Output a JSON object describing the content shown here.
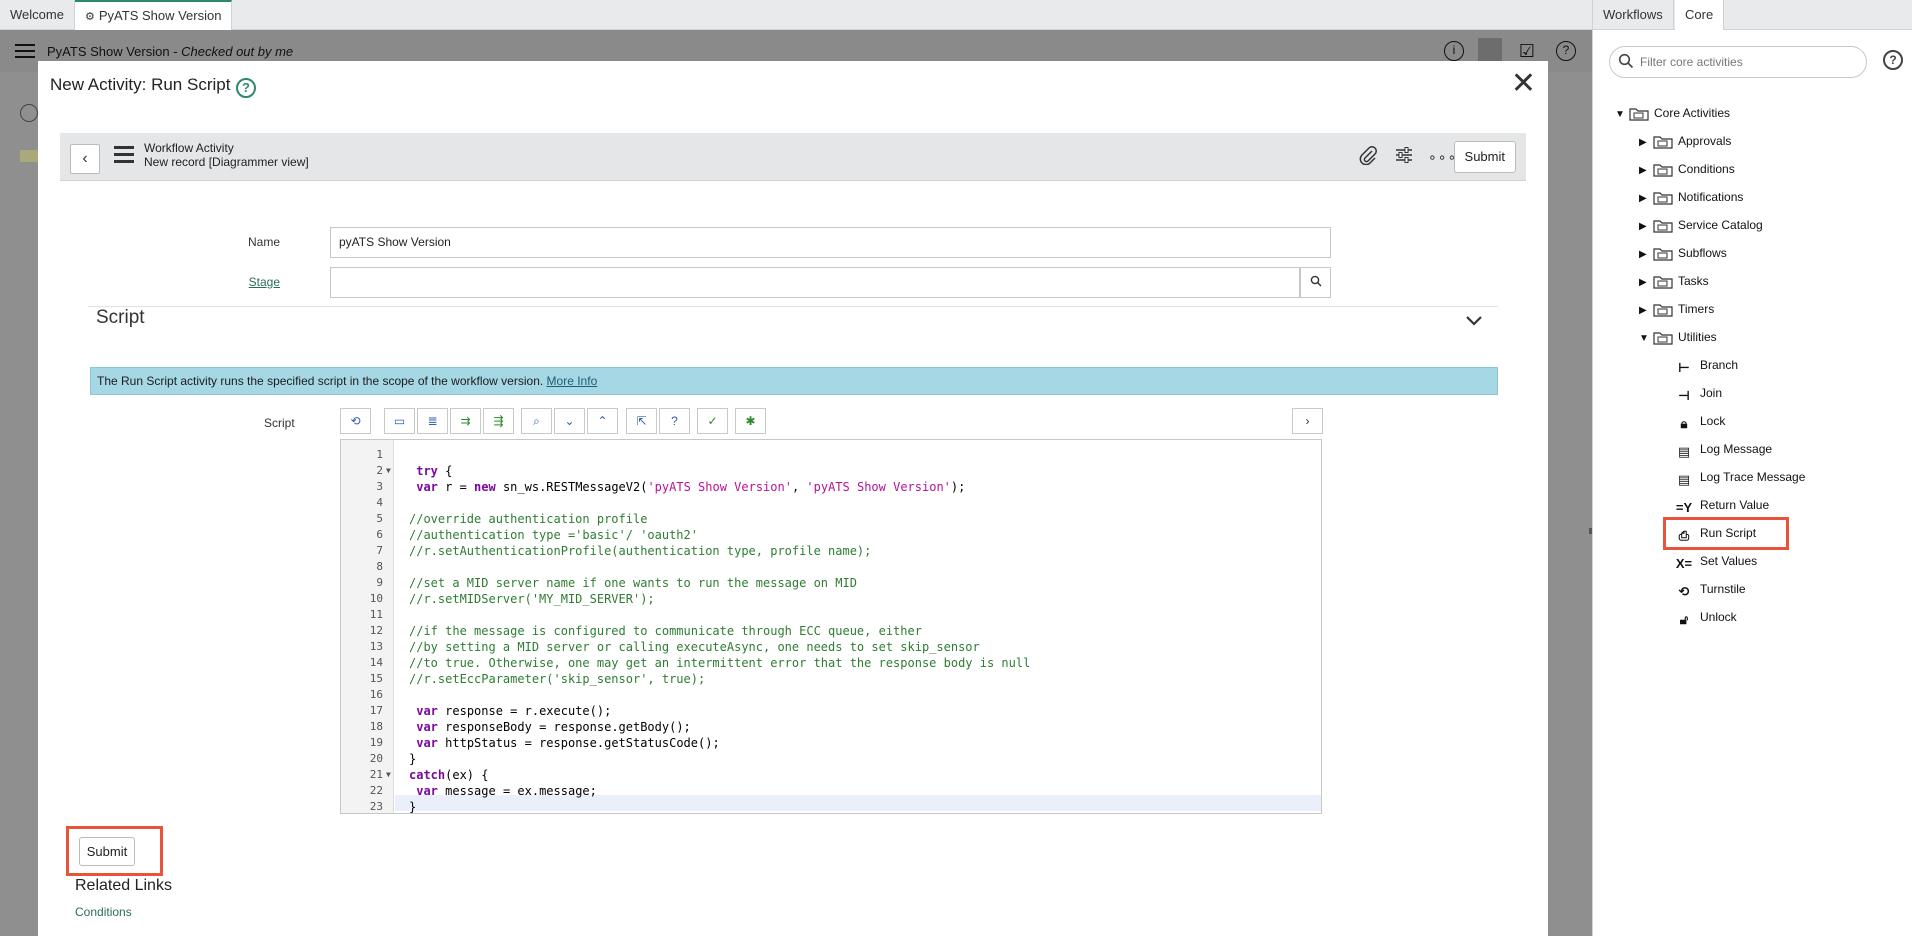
{
  "tabs": [
    {
      "label": "Welcome"
    },
    {
      "label": "PyATS Show Version"
    }
  ],
  "app_header": {
    "title": "PyATS Show Version - ",
    "status": "Checked out by me"
  },
  "modal": {
    "title": "New Activity: Run Script",
    "help_icon": "?",
    "close_icon": "✕"
  },
  "record_header": {
    "type": "Workflow Activity",
    "subtitle": "New record [Diagrammer view]",
    "submit_label": "Submit"
  },
  "form": {
    "name_label": "Name",
    "name_value": "pyATS Show Version",
    "stage_label": "Stage",
    "stage_value": ""
  },
  "script_section": {
    "header": "Script",
    "info_text": "The Run Script activity runs the specified script in the scope of the workflow version.",
    "info_link": "More Info",
    "script_label": "Script"
  },
  "code_lines": [
    "",
    " try {",
    " var r = new sn_ws.RESTMessageV2('pyATS Show Version', 'pyATS Show Version');",
    "",
    "//override authentication profile",
    "//authentication type ='basic'/ 'oauth2'",
    "//r.setAuthenticationProfile(authentication type, profile name);",
    "",
    "//set a MID server name if one wants to run the message on MID",
    "//r.setMIDServer('MY_MID_SERVER');",
    "",
    "//if the message is configured to communicate through ECC queue, either",
    "//by setting a MID server or calling executeAsync, one needs to set skip_sensor",
    "//to true. Otherwise, one may get an intermittent error that the response body is null",
    "//r.setEccParameter('skip_sensor', true);",
    "",
    " var response = r.execute();",
    " var responseBody = response.getBody();",
    " var httpStatus = response.getStatusCode();",
    "}",
    "catch(ex) {",
    " var message = ex.message;",
    "}"
  ],
  "bottom": {
    "submit_label": "Submit",
    "related_links": "Related Links",
    "conditions_link": "Conditions"
  },
  "right_panel": {
    "tabs": [
      {
        "label": "Workflows"
      },
      {
        "label": "Core"
      }
    ],
    "filter_placeholder": "Filter core activities",
    "help_icon": "?",
    "root": "Core Activities",
    "folders": [
      {
        "label": "Approvals"
      },
      {
        "label": "Conditions"
      },
      {
        "label": "Notifications"
      },
      {
        "label": "Service Catalog"
      },
      {
        "label": "Subflows"
      },
      {
        "label": "Tasks"
      },
      {
        "label": "Timers"
      },
      {
        "label": "Utilities"
      }
    ],
    "utilities": [
      {
        "label": "Branch",
        "icon": "branch-icon"
      },
      {
        "label": "Join",
        "icon": "join-icon"
      },
      {
        "label": "Lock",
        "icon": "lock-icon"
      },
      {
        "label": "Log Message",
        "icon": "log-message-icon"
      },
      {
        "label": "Log Trace Message",
        "icon": "log-trace-icon"
      },
      {
        "label": "Return Value",
        "icon": "return-value-icon"
      },
      {
        "label": "Run Script",
        "icon": "run-script-icon"
      },
      {
        "label": "Set Values",
        "icon": "set-values-icon"
      },
      {
        "label": "Turnstile",
        "icon": "turnstile-icon"
      },
      {
        "label": "Unlock",
        "icon": "unlock-icon"
      }
    ]
  },
  "colors": {
    "accent": "#2c8a6a",
    "highlight": "#e8543a",
    "info_bar": "#a5d7e4"
  }
}
